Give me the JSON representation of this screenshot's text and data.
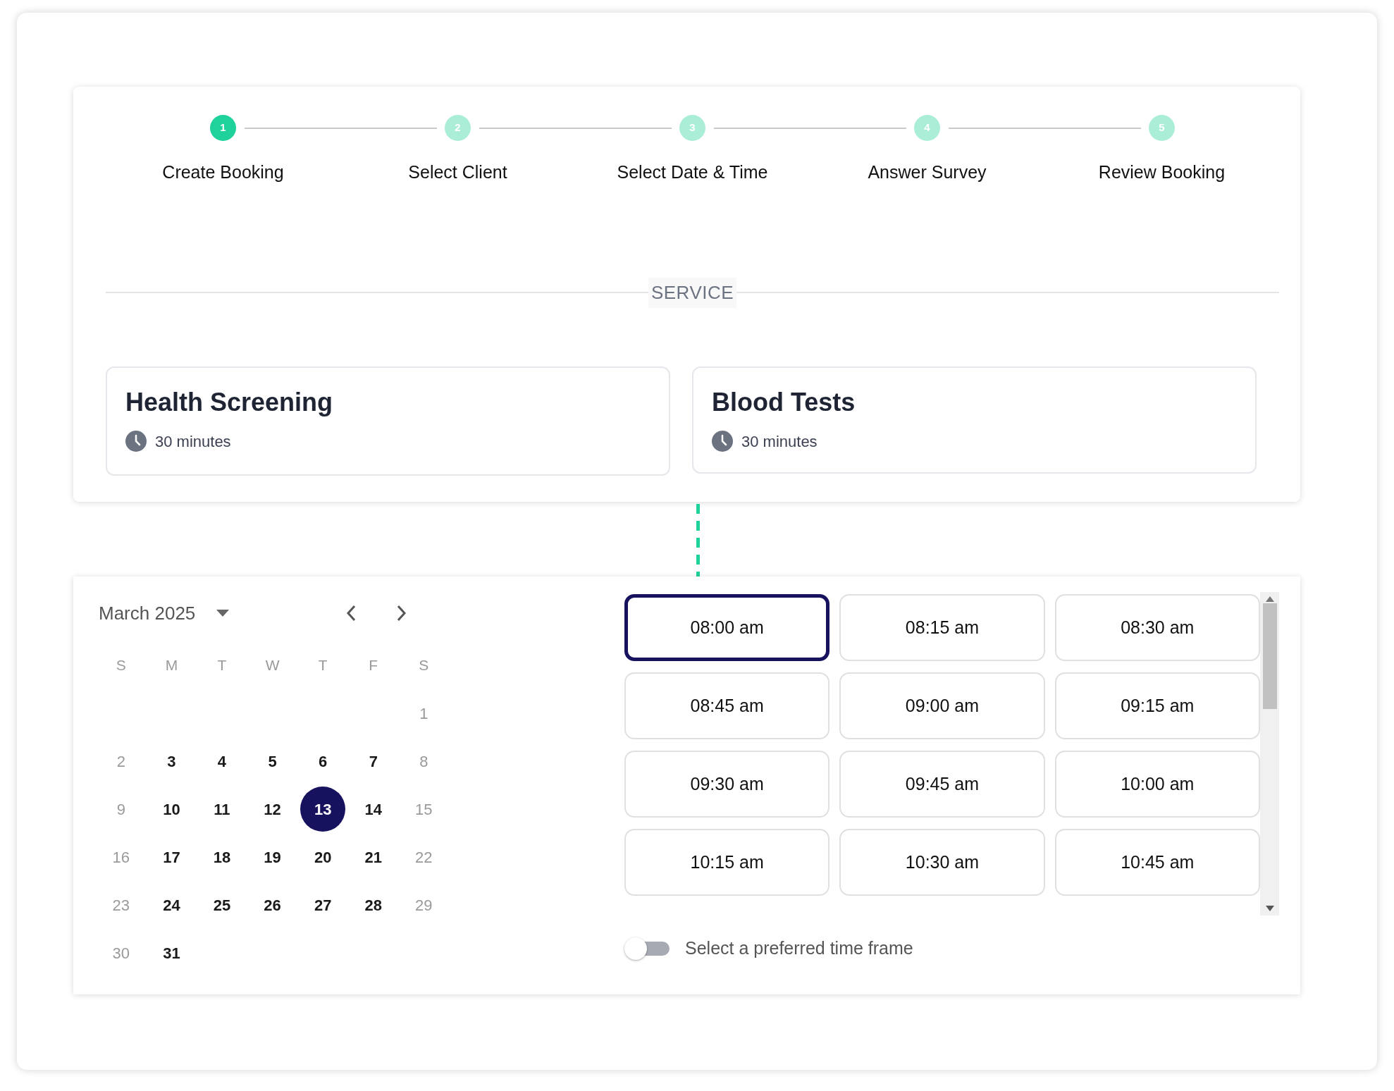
{
  "steps": [
    {
      "number": "1",
      "label": "Create Booking",
      "selected": true
    },
    {
      "number": "2",
      "label": "Select Client",
      "selected": false
    },
    {
      "number": "3",
      "label": "Select Date & Time",
      "selected": false
    },
    {
      "number": "4",
      "label": "Answer Survey",
      "selected": false
    },
    {
      "number": "5",
      "label": "Review Booking",
      "selected": false
    }
  ],
  "section_title": "SERVICE",
  "services": [
    {
      "title": "Health Screening",
      "duration": "30 minutes"
    },
    {
      "title": "Blood Tests",
      "duration": "30 minutes"
    }
  ],
  "calendar": {
    "month": "March 2025",
    "weekdays": [
      "S",
      "M",
      "T",
      "W",
      "T",
      "F",
      "S"
    ],
    "weeks": [
      [
        {
          "day": "1",
          "disabled": true,
          "selected": false
        }
      ],
      [
        {
          "day": "2",
          "disabled": true,
          "selected": false
        },
        {
          "day": "3",
          "disabled": false,
          "selected": false
        },
        {
          "day": "4",
          "disabled": false,
          "selected": false
        },
        {
          "day": "5",
          "disabled": false,
          "selected": false
        },
        {
          "day": "6",
          "disabled": false,
          "selected": false
        },
        {
          "day": "7",
          "disabled": false,
          "selected": false
        },
        {
          "day": "8",
          "disabled": true,
          "selected": false
        }
      ],
      [
        {
          "day": "9",
          "disabled": true,
          "selected": false
        },
        {
          "day": "10",
          "disabled": false,
          "selected": false
        },
        {
          "day": "11",
          "disabled": false,
          "selected": false
        },
        {
          "day": "12",
          "disabled": false,
          "selected": false
        },
        {
          "day": "13",
          "disabled": false,
          "selected": true
        },
        {
          "day": "14",
          "disabled": false,
          "selected": false
        },
        {
          "day": "15",
          "disabled": true,
          "selected": false
        }
      ],
      [
        {
          "day": "16",
          "disabled": true,
          "selected": false
        },
        {
          "day": "17",
          "disabled": false,
          "selected": false
        },
        {
          "day": "18",
          "disabled": false,
          "selected": false
        },
        {
          "day": "19",
          "disabled": false,
          "selected": false
        },
        {
          "day": "20",
          "disabled": false,
          "selected": false
        },
        {
          "day": "21",
          "disabled": false,
          "selected": false
        },
        {
          "day": "22",
          "disabled": true,
          "selected": false
        }
      ],
      [
        {
          "day": "23",
          "disabled": true,
          "selected": false
        },
        {
          "day": "24",
          "disabled": false,
          "selected": false
        },
        {
          "day": "25",
          "disabled": false,
          "selected": false
        },
        {
          "day": "26",
          "disabled": false,
          "selected": false
        },
        {
          "day": "27",
          "disabled": false,
          "selected": false
        },
        {
          "day": "28",
          "disabled": false,
          "selected": false
        },
        {
          "day": "29",
          "disabled": true,
          "selected": false
        }
      ],
      [
        {
          "day": "30",
          "disabled": true,
          "selected": false
        },
        {
          "day": "31",
          "disabled": false,
          "selected": false
        }
      ]
    ]
  },
  "time_slots": [
    {
      "time": "08:00 am",
      "selected": true
    },
    {
      "time": "08:15 am",
      "selected": false
    },
    {
      "time": "08:30 am",
      "selected": false
    },
    {
      "time": "08:45 am",
      "selected": false
    },
    {
      "time": "09:00 am",
      "selected": false
    },
    {
      "time": "09:15 am",
      "selected": false
    },
    {
      "time": "09:30 am",
      "selected": false
    },
    {
      "time": "09:45 am",
      "selected": false
    },
    {
      "time": "10:00 am",
      "selected": false
    },
    {
      "time": "10:15 am",
      "selected": false
    },
    {
      "time": "10:30 am",
      "selected": false
    },
    {
      "time": "10:45 am",
      "selected": false
    }
  ],
  "time_frame_toggle": {
    "label": "Select a preferred time frame",
    "on": false
  }
}
